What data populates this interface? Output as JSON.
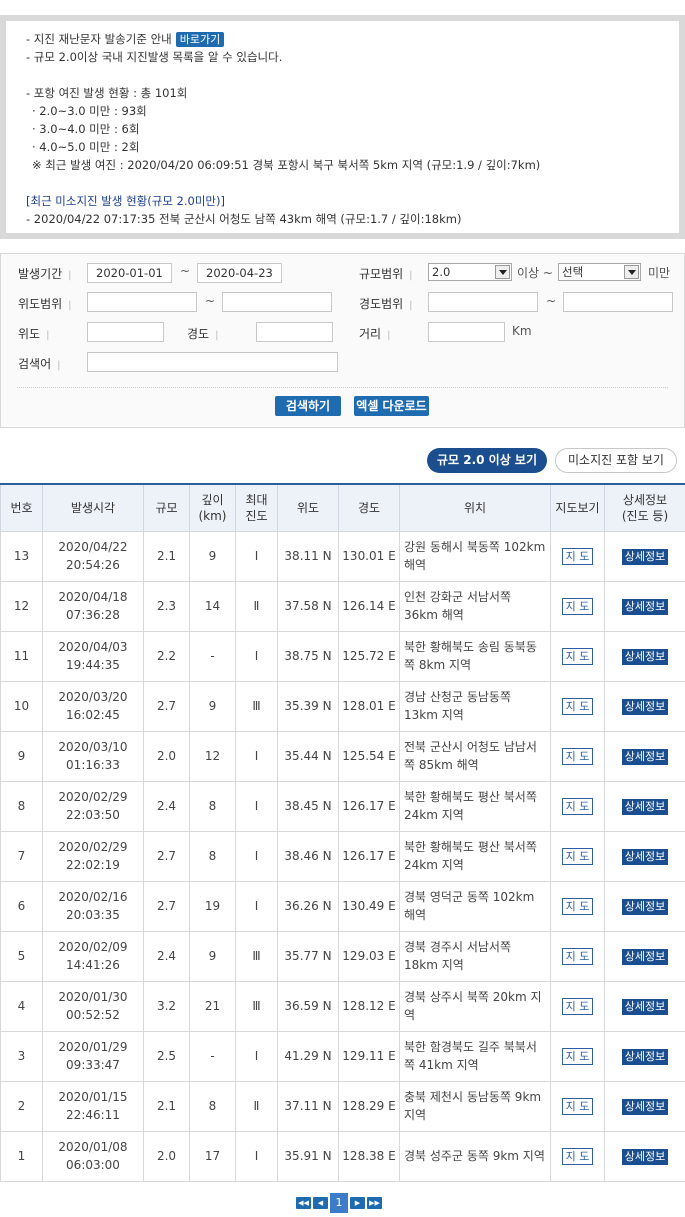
{
  "notice": {
    "line1": "- 지진 재난문자 발송기준 안내",
    "link_label": "바로가기",
    "line2": "- 규모 2.0이상 국내 지진발생 목록을 알 수 있습니다.",
    "line3": "- 포항 여진 발생 현황 : 총 101회",
    "line4": "· 2.0~3.0 미만 : 93회",
    "line5": "· 3.0~4.0 미만 : 6회",
    "line6": "· 4.0~5.0 미만 : 2회",
    "line7": "※ 최근 발생 여진 : 2020/04/20 06:09:51 경북 포항시 북구 북서쪽 5km 지역 (규모:1.9 / 깊이:7km)",
    "mini_title": "[최근 미소지진 발생 현황(규모 2.0미만)]",
    "mini_line": "- 2020/04/22 07:17:35 전북 군산시 어청도 남쪽 43km 해역 (규모:1.7 / 깊이:18km)"
  },
  "search": {
    "date_label": "발생기간",
    "date_from": "2020-01-01",
    "date_to": "2020-04-23",
    "tilde": "~",
    "mag_label": "규모범위",
    "mag_from": "2.0",
    "mag_above": "이상 ~",
    "mag_to": "선택",
    "mag_below": "미만",
    "lat_range_label": "위도범위",
    "lon_range_label": "경도범위",
    "lat_label": "위도",
    "lon_label": "경도",
    "dist_label": "거리",
    "dist_unit": "Km",
    "keyword_label": "검색어",
    "search_button": "검색하기",
    "excel_button": "엑셀 다운로드"
  },
  "toggles": {
    "on_label": "규모 2.0 이상 보기",
    "off_label": "미소지진 포함 보기"
  },
  "table": {
    "headers": [
      "번호",
      "발생시각",
      "규모",
      "깊이\n(km)",
      "최대\n진도",
      "위도",
      "경도",
      "위치",
      "지도보기",
      "상세정보\n(진도 등)"
    ],
    "map_label": "지 도",
    "detail_label": "상세정보",
    "rows": [
      {
        "no": "13",
        "date": "2020/04/22",
        "time": "20:54:26",
        "mag": "2.1",
        "depth": "9",
        "intensity": "Ⅰ",
        "lat": "38.11 N",
        "lon": "130.01 E",
        "loc": "강원 동해시 북동쪽 102km 해역"
      },
      {
        "no": "12",
        "date": "2020/04/18",
        "time": "07:36:28",
        "mag": "2.3",
        "depth": "14",
        "intensity": "Ⅱ",
        "lat": "37.58 N",
        "lon": "126.14 E",
        "loc": "인천 강화군 서남서쪽 36km 해역"
      },
      {
        "no": "11",
        "date": "2020/04/03",
        "time": "19:44:35",
        "mag": "2.2",
        "depth": "-",
        "intensity": "Ⅰ",
        "lat": "38.75 N",
        "lon": "125.72 E",
        "loc": "북한 황해북도 송림 동북동쪽 8km 지역"
      },
      {
        "no": "10",
        "date": "2020/03/20",
        "time": "16:02:45",
        "mag": "2.7",
        "depth": "9",
        "intensity": "Ⅲ",
        "lat": "35.39 N",
        "lon": "128.01 E",
        "loc": "경남 산청군 동남동쪽 13km 지역"
      },
      {
        "no": "9",
        "date": "2020/03/10",
        "time": "01:16:33",
        "mag": "2.0",
        "depth": "12",
        "intensity": "Ⅰ",
        "lat": "35.44 N",
        "lon": "125.54 E",
        "loc": "전북 군산시 어청도 남남서쪽 85km 해역"
      },
      {
        "no": "8",
        "date": "2020/02/29",
        "time": "22:03:50",
        "mag": "2.4",
        "depth": "8",
        "intensity": "Ⅰ",
        "lat": "38.45 N",
        "lon": "126.17 E",
        "loc": "북한 황해북도 평산 북서쪽 24km 지역"
      },
      {
        "no": "7",
        "date": "2020/02/29",
        "time": "22:02:19",
        "mag": "2.7",
        "depth": "8",
        "intensity": "Ⅰ",
        "lat": "38.46 N",
        "lon": "126.17 E",
        "loc": "북한 황해북도 평산 북서쪽 24km 지역"
      },
      {
        "no": "6",
        "date": "2020/02/16",
        "time": "20:03:35",
        "mag": "2.7",
        "depth": "19",
        "intensity": "Ⅰ",
        "lat": "36.26 N",
        "lon": "130.49 E",
        "loc": "경북 영덕군 동쪽 102km 해역"
      },
      {
        "no": "5",
        "date": "2020/02/09",
        "time": "14:41:26",
        "mag": "2.4",
        "depth": "9",
        "intensity": "Ⅲ",
        "lat": "35.77 N",
        "lon": "129.03 E",
        "loc": "경북 경주시 서남서쪽 18km 지역"
      },
      {
        "no": "4",
        "date": "2020/01/30",
        "time": "00:52:52",
        "mag": "3.2",
        "depth": "21",
        "intensity": "Ⅲ",
        "lat": "36.59 N",
        "lon": "128.12 E",
        "loc": "경북 상주시 북쪽 20km 지역"
      },
      {
        "no": "3",
        "date": "2020/01/29",
        "time": "09:33:47",
        "mag": "2.5",
        "depth": "-",
        "intensity": "Ⅰ",
        "lat": "41.29 N",
        "lon": "129.11 E",
        "loc": "북한 함경북도 길주 북북서쪽 41km 지역"
      },
      {
        "no": "2",
        "date": "2020/01/15",
        "time": "22:46:11",
        "mag": "2.1",
        "depth": "8",
        "intensity": "Ⅱ",
        "lat": "37.11 N",
        "lon": "128.29 E",
        "loc": "충북 제천시 동남동쪽 9km 지역"
      },
      {
        "no": "1",
        "date": "2020/01/08",
        "time": "06:03:00",
        "mag": "2.0",
        "depth": "17",
        "intensity": "Ⅰ",
        "lat": "35.91 N",
        "lon": "128.38 E",
        "loc": "경북 성주군 동쪽 9km 지역"
      }
    ]
  },
  "pager": {
    "first": "◀◀",
    "prev": "◀",
    "current": "1",
    "next": "▶",
    "last": "▶▶"
  }
}
